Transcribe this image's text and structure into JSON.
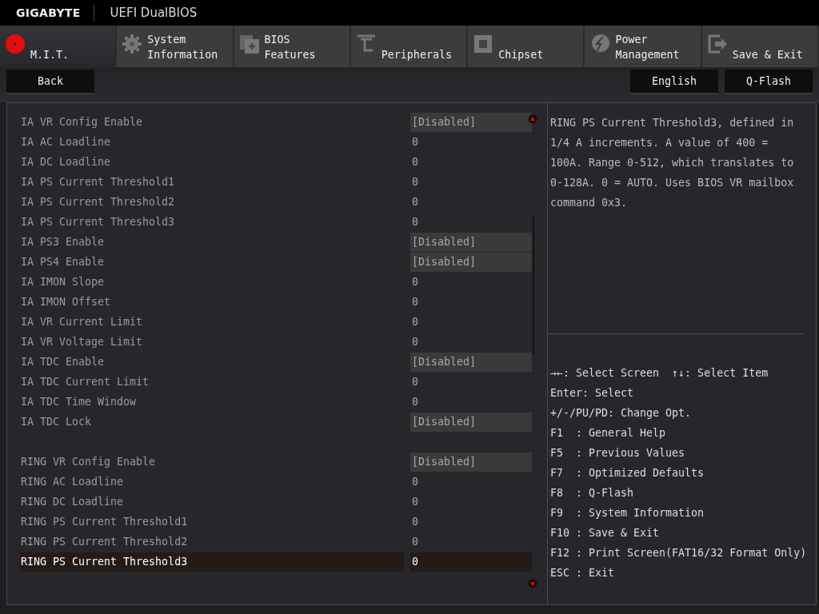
{
  "header": {
    "brand": "GIGABYTE",
    "title": "UEFI DualBIOS"
  },
  "tabs": [
    {
      "label": "M.I.T.",
      "selected": true
    },
    {
      "label": "System Information",
      "selected": false
    },
    {
      "label": "BIOS Features",
      "selected": false
    },
    {
      "label": "Peripherals",
      "selected": false
    },
    {
      "label": "Chipset",
      "selected": false
    },
    {
      "label": "Power Management",
      "selected": false
    },
    {
      "label": "Save & Exit",
      "selected": false
    }
  ],
  "toolbar": {
    "left": [
      "Back"
    ],
    "right": [
      "English",
      "Q-Flash"
    ]
  },
  "settings": [
    [
      {
        "label": "IA VR Config Enable",
        "value": "[Disabled]",
        "kind": "option",
        "selected": false
      },
      {
        "label": "IA AC Loadline",
        "value": "0",
        "kind": "number",
        "selected": false
      },
      {
        "label": "IA DC Loadline",
        "value": "0",
        "kind": "number",
        "selected": false
      },
      {
        "label": "IA PS Current Threshold1",
        "value": "0",
        "kind": "number",
        "selected": false
      },
      {
        "label": "IA PS Current Threshold2",
        "value": "0",
        "kind": "number",
        "selected": false
      },
      {
        "label": "IA PS Current Threshold3",
        "value": "0",
        "kind": "number",
        "selected": false
      },
      {
        "label": "IA PS3 Enable",
        "value": "[Disabled]",
        "kind": "option",
        "selected": false
      },
      {
        "label": "IA PS4 Enable",
        "value": "[Disabled]",
        "kind": "option",
        "selected": false
      },
      {
        "label": "IA IMON Slope",
        "value": "0",
        "kind": "number",
        "selected": false
      },
      {
        "label": "IA IMON Offset",
        "value": "0",
        "kind": "number",
        "selected": false
      },
      {
        "label": "IA VR Current Limit",
        "value": "0",
        "kind": "number",
        "selected": false
      },
      {
        "label": "IA VR Voltage Limit",
        "value": "0",
        "kind": "number",
        "selected": false
      },
      {
        "label": "IA TDC Enable",
        "value": "[Disabled]",
        "kind": "option",
        "selected": false
      },
      {
        "label": "IA TDC Current Limit",
        "value": "0",
        "kind": "number",
        "selected": false
      },
      {
        "label": "IA TDC Time Window",
        "value": "0",
        "kind": "number",
        "selected": false
      },
      {
        "label": "IA TDC Lock",
        "value": "[Disabled]",
        "kind": "option",
        "selected": false
      }
    ],
    [
      {
        "label": "RING VR Config Enable",
        "value": "[Disabled]",
        "kind": "option",
        "selected": false
      },
      {
        "label": "RING AC Loadline",
        "value": "0",
        "kind": "number",
        "selected": false
      },
      {
        "label": "RING DC Loadline",
        "value": "0",
        "kind": "number",
        "selected": false
      },
      {
        "label": "RING PS Current Threshold1",
        "value": "0",
        "kind": "number",
        "selected": false
      },
      {
        "label": "RING PS Current Threshold2",
        "value": "0",
        "kind": "number",
        "selected": false
      },
      {
        "label": "RING PS Current Threshold3",
        "value": "0",
        "kind": "number",
        "selected": true
      }
    ]
  ],
  "help": "RING PS Current Threshold3, defined in 1/4 A increments. A value of 400 = 100A. Range 0-512, which translates to 0-128A. 0 = AUTO. Uses BIOS VR mailbox command 0x3.",
  "keys": [
    "→←: Select Screen  ↑↓: Select Item",
    "Enter: Select",
    "+/-/PU/PD: Change Opt.",
    "F1  : General Help",
    "F5  : Previous Values",
    "F7  : Optimized Defaults",
    "F8  : Q-Flash",
    "F9  : System Information",
    "F10 : Save & Exit",
    "F12 : Print Screen(FAT16/32 Format Only)",
    "ESC : Exit"
  ]
}
